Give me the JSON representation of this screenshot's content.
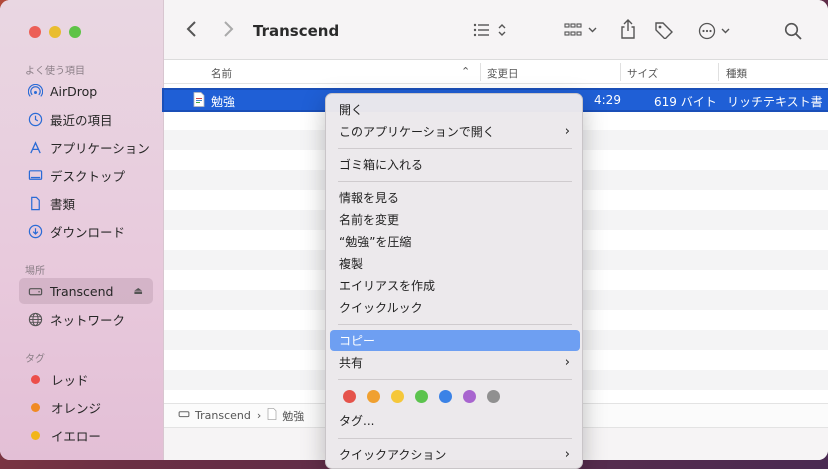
{
  "sidebar": {
    "favorites_title": "よく使う項目",
    "favorites": [
      {
        "label": "AirDrop",
        "icon": "airdrop-icon"
      },
      {
        "label": "最近の項目",
        "icon": "clock-icon"
      },
      {
        "label": "アプリケーション",
        "icon": "applications-icon"
      },
      {
        "label": "デスクトップ",
        "icon": "desktop-icon"
      },
      {
        "label": "書類",
        "icon": "document-icon"
      },
      {
        "label": "ダウンロード",
        "icon": "download-icon"
      }
    ],
    "locations_title": "場所",
    "locations": [
      {
        "label": "Transcend",
        "icon": "drive-icon",
        "selected": true
      },
      {
        "label": "ネットワーク",
        "icon": "network-icon"
      }
    ],
    "tags_title": "タグ",
    "tags": [
      {
        "label": "レッド",
        "color": "#ec4e4a"
      },
      {
        "label": "オレンジ",
        "color": "#f08a24"
      },
      {
        "label": "イエロー",
        "color": "#f2b51b"
      }
    ]
  },
  "toolbar": {
    "title": "Transcend"
  },
  "columns": {
    "name": "名前",
    "modified": "変更日",
    "size": "サイズ",
    "kind": "種類"
  },
  "selected_file": {
    "name": "勉強",
    "modified": "4:29",
    "size": "619 バイト",
    "kind": "リッチテキスト書"
  },
  "pathbar": {
    "root": "Transcend",
    "separator": "›",
    "file": "勉強"
  },
  "context_menu": {
    "open": "開く",
    "open_with": "このアプリケーションで開く",
    "trash": "ゴミ箱に入れる",
    "get_info": "情報を見る",
    "rename": "名前を変更",
    "compress": "“勉強”を圧縮",
    "duplicate": "複製",
    "alias": "エイリアスを作成",
    "quicklook": "クイックルック",
    "copy": "コピー",
    "share": "共有",
    "tags": "タグ...",
    "quick_actions": "クイックアクション",
    "tag_colors": [
      "#e5534b",
      "#f0a030",
      "#f5c73a",
      "#5cc34e",
      "#3b82e6",
      "#a865cf",
      "#909090"
    ]
  }
}
